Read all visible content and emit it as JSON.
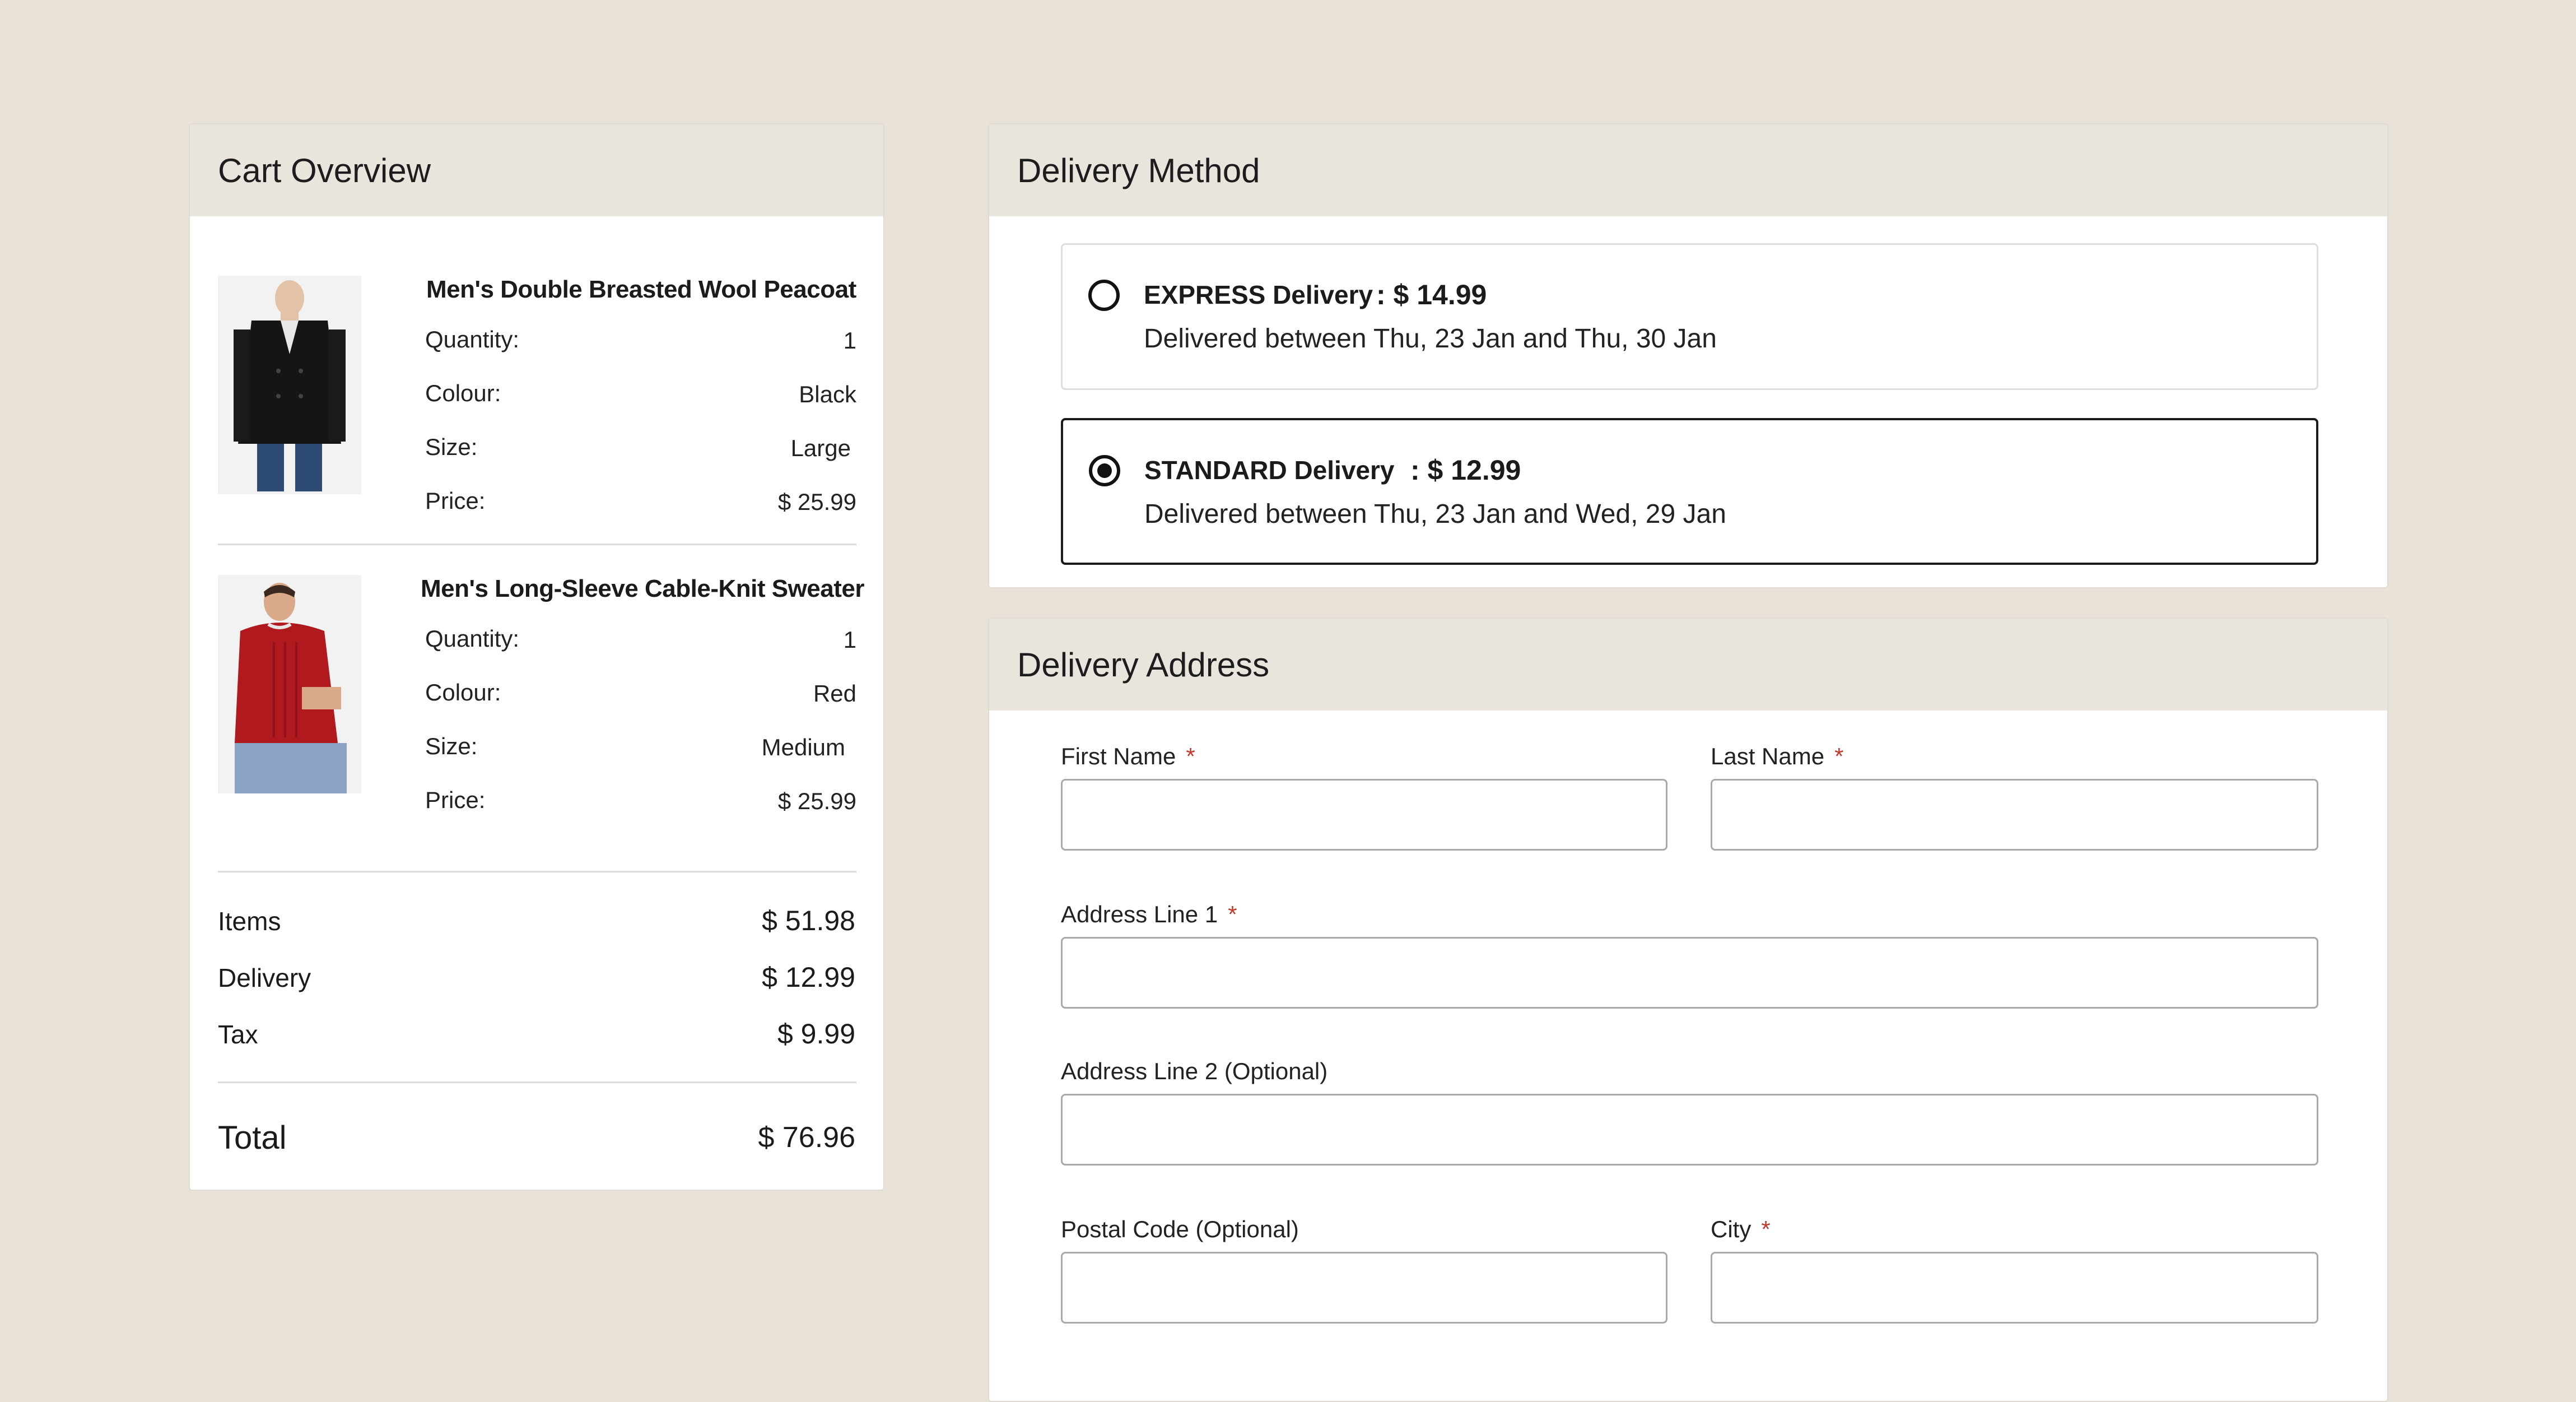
{
  "cart": {
    "title": "Cart Overview",
    "items": [
      {
        "name": "Men's Double Breasted Wool Peacoat",
        "image": "black-peacoat-photo",
        "specs": [
          {
            "label": "Quantity:",
            "value": "1"
          },
          {
            "label": "Colour:",
            "value": "Black"
          },
          {
            "label": "Size:",
            "value": "Large"
          },
          {
            "label": "Price:",
            "value": "$ 25.99"
          }
        ]
      },
      {
        "name": "Men's Long-Sleeve Cable-Knit Sweater",
        "image": "red-sweater-photo",
        "specs": [
          {
            "label": "Quantity:",
            "value": "1"
          },
          {
            "label": "Colour:",
            "value": "Red"
          },
          {
            "label": "Size:",
            "value": "Medium"
          },
          {
            "label": "Price:",
            "value": "$ 25.99"
          }
        ]
      }
    ],
    "summary": [
      {
        "label": "Items",
        "value": "$ 51.98"
      },
      {
        "label": "Delivery",
        "value": "$ 12.99"
      },
      {
        "label": "Tax",
        "value": "$ 9.99"
      }
    ],
    "total": {
      "label": "Total",
      "value": "$ 76.96"
    }
  },
  "delivery_method": {
    "title": "Delivery Method",
    "options": [
      {
        "title": "EXPRESS Delivery",
        "price": ": $ 14.99",
        "desc": "Delivered between Thu, 23 Jan and Thu, 30 Jan",
        "selected": false
      },
      {
        "title": "STANDARD Delivery",
        "price": ": $ 12.99",
        "desc": "Delivered between Thu, 23 Jan and Wed, 29 Jan",
        "selected": true
      }
    ]
  },
  "delivery_address": {
    "title": "Delivery Address",
    "required_mark": "*",
    "fields": {
      "first_name": {
        "label": "First Name",
        "value": ""
      },
      "last_name": {
        "label": "Last Name",
        "value": ""
      },
      "address1": {
        "label": "Address Line 1",
        "value": ""
      },
      "address2": {
        "label": "Address Line 2 (Optional)",
        "value": ""
      },
      "postal_code": {
        "label": "Postal Code (Optional)",
        "value": ""
      },
      "city": {
        "label": "City",
        "value": ""
      }
    }
  },
  "colors": {
    "page_bg": "#e8e2d8",
    "header_bg": "#e9e5dd",
    "required": "#c0392b",
    "selected_border": "#1b1b1b"
  }
}
